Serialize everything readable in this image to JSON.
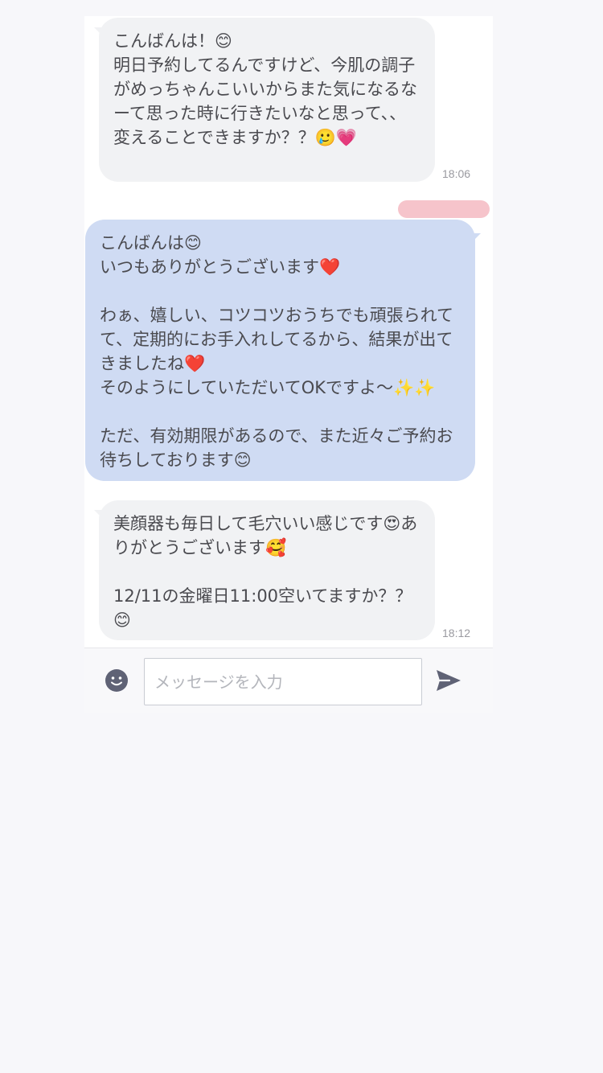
{
  "chat": {
    "messages": [
      {
        "direction": "incoming",
        "text": "こんばんは！😊\n明日予約してるんですけど、今肌の調子がめっちゃんこいいからまた気になるなーて思った時に行きたいなと思って、、変えることできますか？？🥲💗",
        "time": "18:06"
      },
      {
        "direction": "outgoing",
        "text": "こんばんは😊\nいつもありがとうございます❤️\n\nわぁ、嬉しい、コツコツおうちでも頑張られてて、定期的にお手入れしてるから、結果が出てきましたね❤️\nそのようにしていただいてOKですよ〜✨✨\n\nただ、有効期限があるので、また近々ご予約お待ちしております😊",
        "time": ""
      },
      {
        "direction": "incoming",
        "text": "美顔器も毎日して毛穴いい感じです😍ありがとうございます🥰\n\n12/11の金曜日11:00空いてますか？？😊",
        "time": "18:12"
      }
    ]
  },
  "composer": {
    "placeholder": "メッセージを入力",
    "value": "",
    "emoji_icon": "smiley-icon",
    "send_icon": "paper-plane-icon"
  },
  "colors": {
    "incoming_bubble": "#f1f2f4",
    "outgoing_bubble": "#cfdbf3",
    "redaction": "#f6c4cb",
    "icon": "#5f6275"
  }
}
